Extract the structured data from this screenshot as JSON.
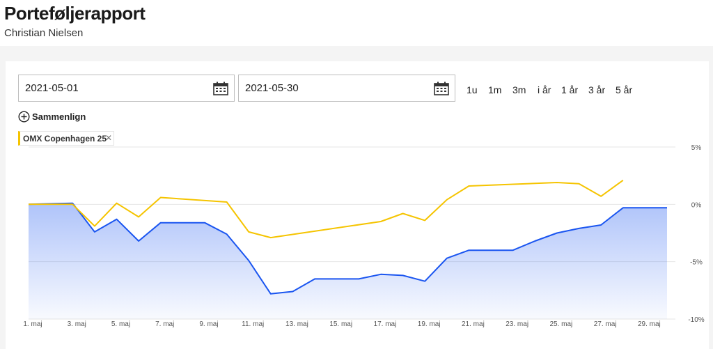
{
  "header": {
    "title": "Porteføljerapport",
    "subtitle": "Christian Nielsen"
  },
  "date_range": {
    "from": "2021-05-01",
    "to": "2021-05-30"
  },
  "range_buttons": [
    "1u",
    "1m",
    "3m",
    "i år",
    "1 år",
    "3 år",
    "5 år"
  ],
  "compare": {
    "label": "Sammenlign"
  },
  "comparison_chip": {
    "label": "OMX Copenhagen 25",
    "color": "#f5c400"
  },
  "colors": {
    "portfolio": "#1a55f0",
    "benchmark": "#f5c400",
    "grid": "#e6e6e6"
  },
  "chart_data": {
    "type": "line",
    "x_tick_labels": [
      "1. maj",
      "3. maj",
      "5. maj",
      "7. maj",
      "9. maj",
      "11. maj",
      "13. maj",
      "15. maj",
      "17. maj",
      "19. maj",
      "21. maj",
      "23. maj",
      "25. maj",
      "27. maj",
      "29. maj"
    ],
    "y_tick_labels": [
      "5%",
      "0%",
      "-5%",
      "-10%"
    ],
    "ylim": [
      -10,
      5
    ],
    "grid": true,
    "series": [
      {
        "key": "portfolio",
        "x": [
          1,
          3,
          4,
          5,
          6,
          7,
          9,
          10,
          11,
          12,
          13,
          14,
          16,
          17,
          18,
          19,
          20,
          21,
          23,
          24,
          25,
          26,
          27,
          28,
          30
        ],
        "values": [
          0,
          0.1,
          -2.4,
          -1.3,
          -3.2,
          -1.6,
          -1.6,
          -2.6,
          -4.9,
          -7.8,
          -7.6,
          -6.5,
          -6.5,
          -6.1,
          -6.2,
          -6.7,
          -4.7,
          -4.0,
          -4.0,
          -3.2,
          -2.5,
          -2.1,
          -1.8,
          -0.3,
          -0.3
        ]
      },
      {
        "key": "benchmark",
        "name": "OMX Copenhagen 25",
        "x": [
          1,
          3,
          4,
          5,
          6,
          7,
          10,
          11,
          12,
          17,
          18,
          19,
          20,
          21,
          25,
          26,
          27,
          28
        ],
        "values": [
          0,
          0,
          -1.9,
          0.1,
          -1.1,
          0.6,
          0.2,
          -2.4,
          -2.9,
          -1.5,
          -0.8,
          -1.4,
          0.4,
          1.6,
          1.9,
          1.8,
          0.7,
          2.1
        ]
      }
    ]
  }
}
